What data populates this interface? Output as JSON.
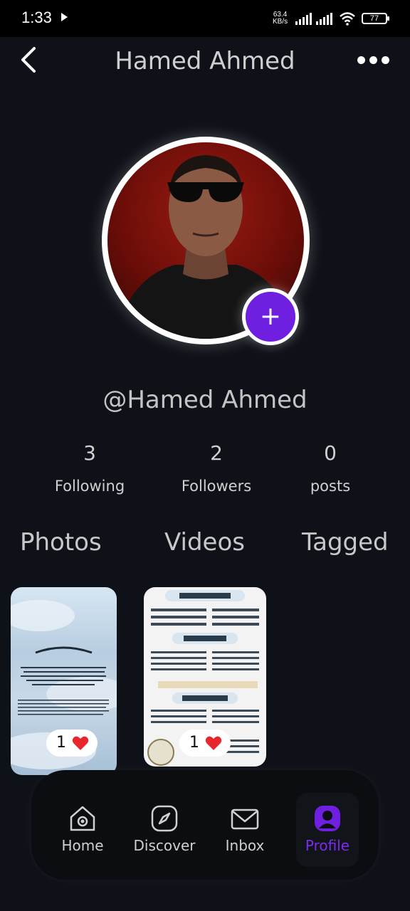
{
  "status_bar": {
    "time": "1:33",
    "net_speed_value": "63.4",
    "net_speed_unit": "KB/s",
    "battery": "77"
  },
  "header": {
    "title": "Hamed Ahmed"
  },
  "profile": {
    "handle": "@Hamed Ahmed",
    "add_button": "+"
  },
  "stats": [
    {
      "value": "3",
      "label": "Following"
    },
    {
      "value": "2",
      "label": "Followers"
    },
    {
      "value": "0",
      "label": "posts"
    }
  ],
  "tabs": [
    "Photos",
    "Videos",
    "Tagged"
  ],
  "posts": [
    {
      "likes": "1"
    },
    {
      "likes": "1"
    }
  ],
  "nav": {
    "items": [
      "Home",
      "Discover",
      "Inbox",
      "Profile"
    ],
    "active": "Profile"
  },
  "colors": {
    "accent": "#6e1fe0",
    "active_label": "#7b2cf0",
    "like": "#e8262d",
    "background": "#0e1218"
  }
}
